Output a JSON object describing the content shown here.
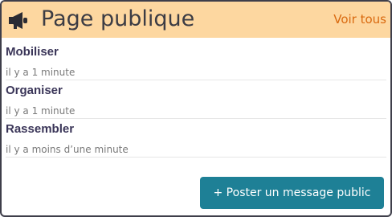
{
  "header": {
    "icon": "megaphone-icon",
    "title": "Page publique",
    "see_all_label": "Voir tous",
    "background_color": "#fdd7a0",
    "link_color": "#d9690f"
  },
  "posts": [
    {
      "title": "Mobiliser",
      "time": "il y a 1 minute"
    },
    {
      "title": "Organiser",
      "time": "il y a 1 minute"
    },
    {
      "title": "Rassembler",
      "time": "il y a moins d’une minute"
    }
  ],
  "actions": {
    "post_button_label": "+ Poster un message public",
    "post_button_color": "#1e8096"
  }
}
